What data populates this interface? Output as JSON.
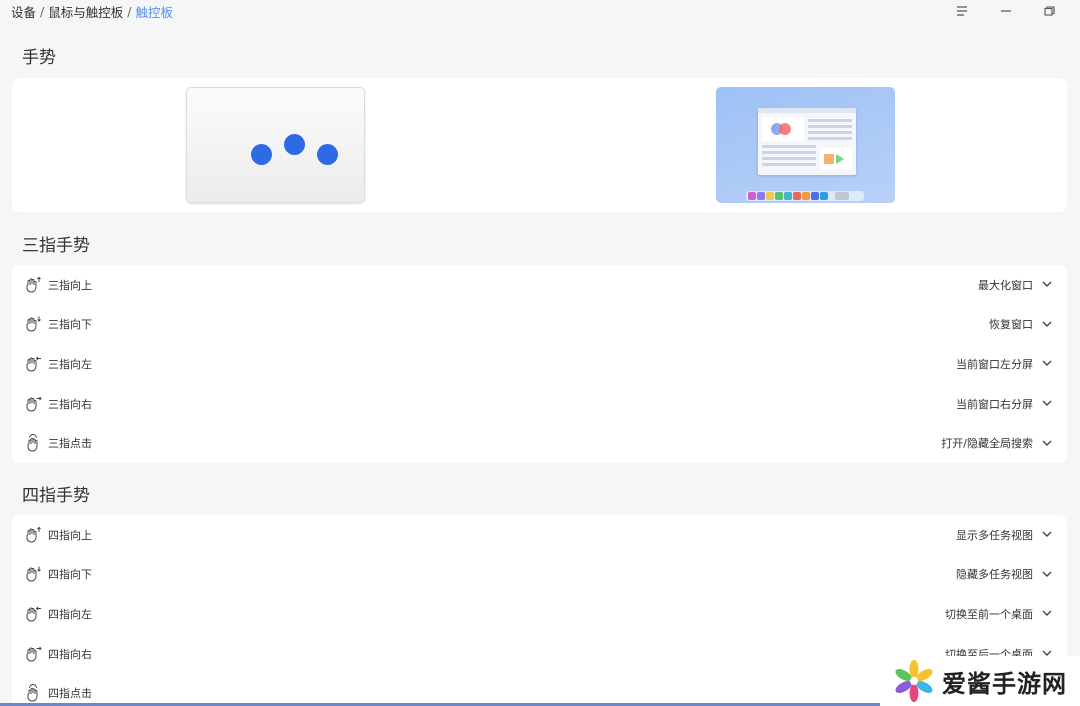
{
  "breadcrumb": {
    "items": [
      "设备",
      "鼠标与触控板"
    ],
    "separator": "/",
    "current": "触控板"
  },
  "window_controls": [
    "menu-icon",
    "minimize-icon",
    "restore-icon"
  ],
  "gestures_section": {
    "title": "手势"
  },
  "three_finger": {
    "title": "三指手势",
    "rows": [
      {
        "label": "三指向上",
        "value": "最大化窗口",
        "icon": "hand-up-icon"
      },
      {
        "label": "三指向下",
        "value": "恢复窗口",
        "icon": "hand-down-icon"
      },
      {
        "label": "三指向左",
        "value": "当前窗口左分屏",
        "icon": "hand-left-icon"
      },
      {
        "label": "三指向右",
        "value": "当前窗口右分屏",
        "icon": "hand-right-icon"
      },
      {
        "label": "三指点击",
        "value": "打开/隐藏全局搜索",
        "icon": "hand-tap-icon"
      }
    ]
  },
  "four_finger": {
    "title": "四指手势",
    "rows": [
      {
        "label": "四指向上",
        "value": "显示多任务视图",
        "icon": "hand-up-icon"
      },
      {
        "label": "四指向下",
        "value": "隐藏多任务视图",
        "icon": "hand-down-icon"
      },
      {
        "label": "四指向左",
        "value": "切换至前一个桌面",
        "icon": "hand-left-icon"
      },
      {
        "label": "四指向右",
        "value": "切换至后一个桌面",
        "icon": "hand-right-icon"
      },
      {
        "label": "四指点击",
        "value": "",
        "icon": "hand-tap-icon"
      }
    ]
  },
  "watermark": {
    "text": "爱酱手游网"
  },
  "colors": {
    "accent": "#5a8fe6",
    "dot": "#2c6be3",
    "background": "#f5f6f7",
    "card": "#ffffff"
  }
}
